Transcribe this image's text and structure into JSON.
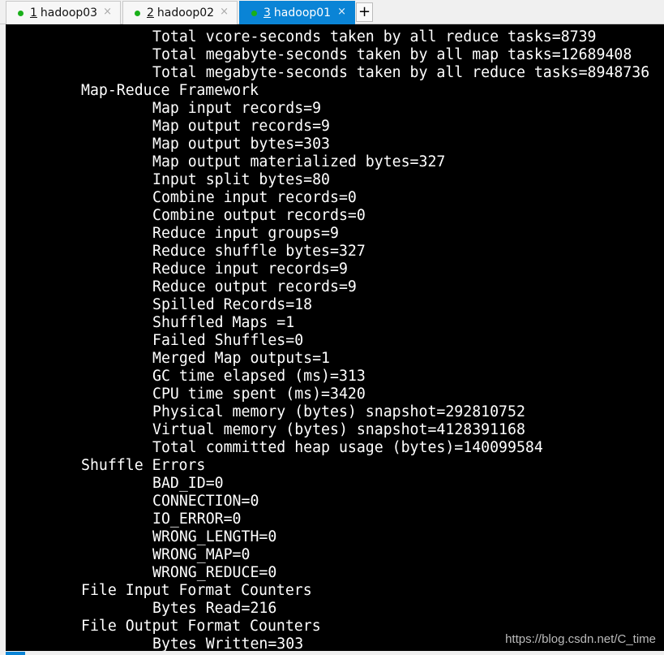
{
  "tabs": [
    {
      "number": "1",
      "label": "hadoop03",
      "active": false,
      "status_color": "#1ab01a"
    },
    {
      "number": "2",
      "label": "hadoop02",
      "active": false,
      "status_color": "#1ab01a"
    },
    {
      "number": "3",
      "label": "hadoop01",
      "active": true,
      "status_color": "#1ab01a"
    }
  ],
  "close_glyph": "×",
  "add_tab_label": "+",
  "terminal": {
    "lines": [
      {
        "indent": 2,
        "text": "Total vcore-seconds taken by all reduce tasks=8739"
      },
      {
        "indent": 2,
        "text": "Total megabyte-seconds taken by all map tasks=12689408"
      },
      {
        "indent": 2,
        "text": "Total megabyte-seconds taken by all reduce tasks=8948736"
      },
      {
        "indent": 1,
        "text": "Map-Reduce Framework"
      },
      {
        "indent": 2,
        "text": "Map input records=9"
      },
      {
        "indent": 2,
        "text": "Map output records=9"
      },
      {
        "indent": 2,
        "text": "Map output bytes=303"
      },
      {
        "indent": 2,
        "text": "Map output materialized bytes=327"
      },
      {
        "indent": 2,
        "text": "Input split bytes=80"
      },
      {
        "indent": 2,
        "text": "Combine input records=0"
      },
      {
        "indent": 2,
        "text": "Combine output records=0"
      },
      {
        "indent": 2,
        "text": "Reduce input groups=9"
      },
      {
        "indent": 2,
        "text": "Reduce shuffle bytes=327"
      },
      {
        "indent": 2,
        "text": "Reduce input records=9"
      },
      {
        "indent": 2,
        "text": "Reduce output records=9"
      },
      {
        "indent": 2,
        "text": "Spilled Records=18"
      },
      {
        "indent": 2,
        "text": "Shuffled Maps =1"
      },
      {
        "indent": 2,
        "text": "Failed Shuffles=0"
      },
      {
        "indent": 2,
        "text": "Merged Map outputs=1"
      },
      {
        "indent": 2,
        "text": "GC time elapsed (ms)=313"
      },
      {
        "indent": 2,
        "text": "CPU time spent (ms)=3420"
      },
      {
        "indent": 2,
        "text": "Physical memory (bytes) snapshot=292810752"
      },
      {
        "indent": 2,
        "text": "Virtual memory (bytes) snapshot=4128391168"
      },
      {
        "indent": 2,
        "text": "Total committed heap usage (bytes)=140099584"
      },
      {
        "indent": 1,
        "text": "Shuffle Errors"
      },
      {
        "indent": 2,
        "text": "BAD_ID=0"
      },
      {
        "indent": 2,
        "text": "CONNECTION=0"
      },
      {
        "indent": 2,
        "text": "IO_ERROR=0"
      },
      {
        "indent": 2,
        "text": "WRONG_LENGTH=0"
      },
      {
        "indent": 2,
        "text": "WRONG_MAP=0"
      },
      {
        "indent": 2,
        "text": "WRONG_REDUCE=0"
      },
      {
        "indent": 1,
        "text": "File Input Format Counters"
      },
      {
        "indent": 2,
        "text": "Bytes Read=216"
      },
      {
        "indent": 1,
        "text": "File Output Format Counters"
      },
      {
        "indent": 2,
        "text": "Bytes Written=303"
      }
    ]
  },
  "watermark": "https://blog.csdn.net/C_time"
}
